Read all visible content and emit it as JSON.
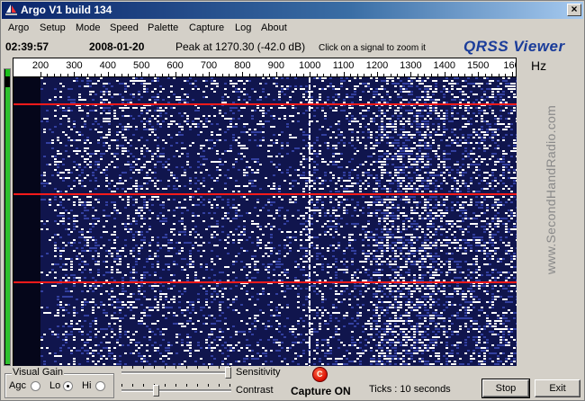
{
  "window": {
    "title": "Argo V1 build 134",
    "close_glyph": "×"
  },
  "menu": [
    "Argo",
    "Setup",
    "Mode",
    "Speed",
    "Palette",
    "Capture",
    "Log",
    "About"
  ],
  "info": {
    "time": "02:39:57",
    "date": "2008-01-20",
    "peak": "Peak at 1270.30 (-42.0 dB)",
    "hint": "Click on a signal to zoom it",
    "brand": "QRSS Viewer"
  },
  "ruler": {
    "ticks": [
      "200",
      "300",
      "400",
      "500",
      "600",
      "700",
      "800",
      "900",
      "1000",
      "1100",
      "1200",
      "1300",
      "1400",
      "1500",
      "160"
    ],
    "unit": "Hz"
  },
  "waterfall": {
    "watermark": "www.SecondHandRadio.com",
    "palette": {
      "background": "#10154d",
      "mid": "#3340a0",
      "high": "#ffffff",
      "marker": "#ff1a1a"
    }
  },
  "level_meter": {
    "level": 0.97,
    "color": "#2ec02e"
  },
  "controls": {
    "visual_gain_label": "Visual Gain",
    "agc_label": "Agc",
    "lo_label": "Lo",
    "hi_label": "Hi",
    "selected_gain": "Lo",
    "sensitivity_label": "Sensitivity",
    "sensitivity_value": 1.0,
    "contrast_label": "Contrast",
    "contrast_value": 0.3,
    "capture_label": "Capture ON",
    "capture_lamp_glyph": "C",
    "ticks_text": "Ticks  : 10 seconds",
    "stop_label": "Stop",
    "exit_label": "Exit"
  }
}
